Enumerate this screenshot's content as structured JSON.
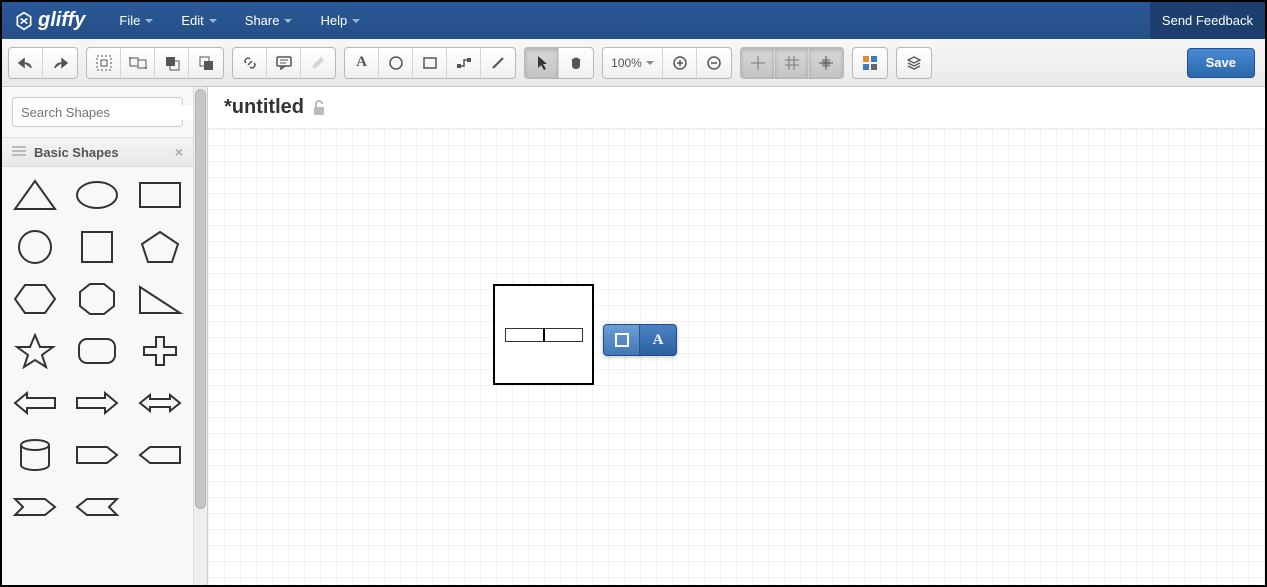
{
  "app": {
    "name": "gliffy"
  },
  "menu": {
    "file": "File",
    "edit": "Edit",
    "share": "Share",
    "help": "Help"
  },
  "header": {
    "feedback": "Send Feedback"
  },
  "toolbar": {
    "zoom": "100%",
    "save": "Save"
  },
  "sidebar": {
    "search_placeholder": "Search Shapes",
    "panel_title": "Basic Shapes"
  },
  "document": {
    "title": "*untitled"
  },
  "context_toolbar": {
    "text_label": "A"
  }
}
